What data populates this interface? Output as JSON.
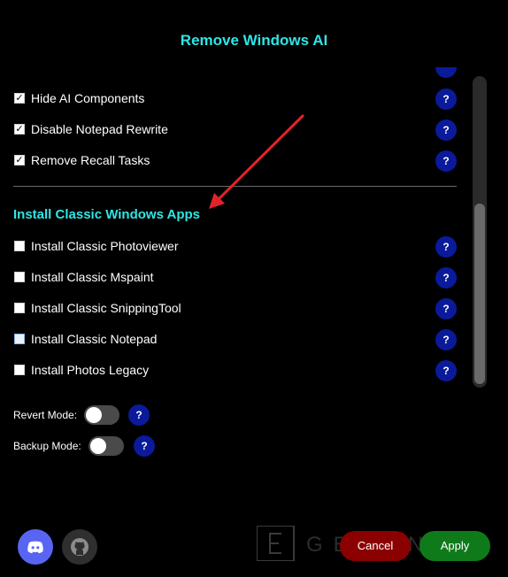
{
  "window": {
    "title": "Remove Windows AI"
  },
  "checks": [
    {
      "label": "Hide AI Components",
      "checked": true
    },
    {
      "label": "Disable Notepad Rewrite",
      "checked": true
    },
    {
      "label": "Remove Recall Tasks",
      "checked": true
    }
  ],
  "section": {
    "title": "Install Classic Windows Apps"
  },
  "apps": [
    {
      "label": "Install Classic Photoviewer",
      "checked": false
    },
    {
      "label": "Install Classic Mspaint",
      "checked": false
    },
    {
      "label": "Install Classic SnippingTool",
      "checked": false
    },
    {
      "label": "Install Classic Notepad",
      "checked": false
    },
    {
      "label": "Install Photos Legacy",
      "checked": false
    }
  ],
  "help": {
    "label": "?"
  },
  "modes": {
    "revert": {
      "label": "Revert Mode:",
      "on": false
    },
    "backup": {
      "label": "Backup Mode:",
      "on": false
    }
  },
  "buttons": {
    "cancel": "Cancel",
    "apply": "Apply"
  },
  "colors": {
    "accent": "#2ee6e6",
    "help": "#0a1a9a",
    "cancel": "#8b0000",
    "apply": "#0f7a1a",
    "arrow": "#e0242a"
  },
  "icons": {
    "social": [
      "discord-icon",
      "github-icon"
    ],
    "annotation": "red-arrow-icon"
  }
}
